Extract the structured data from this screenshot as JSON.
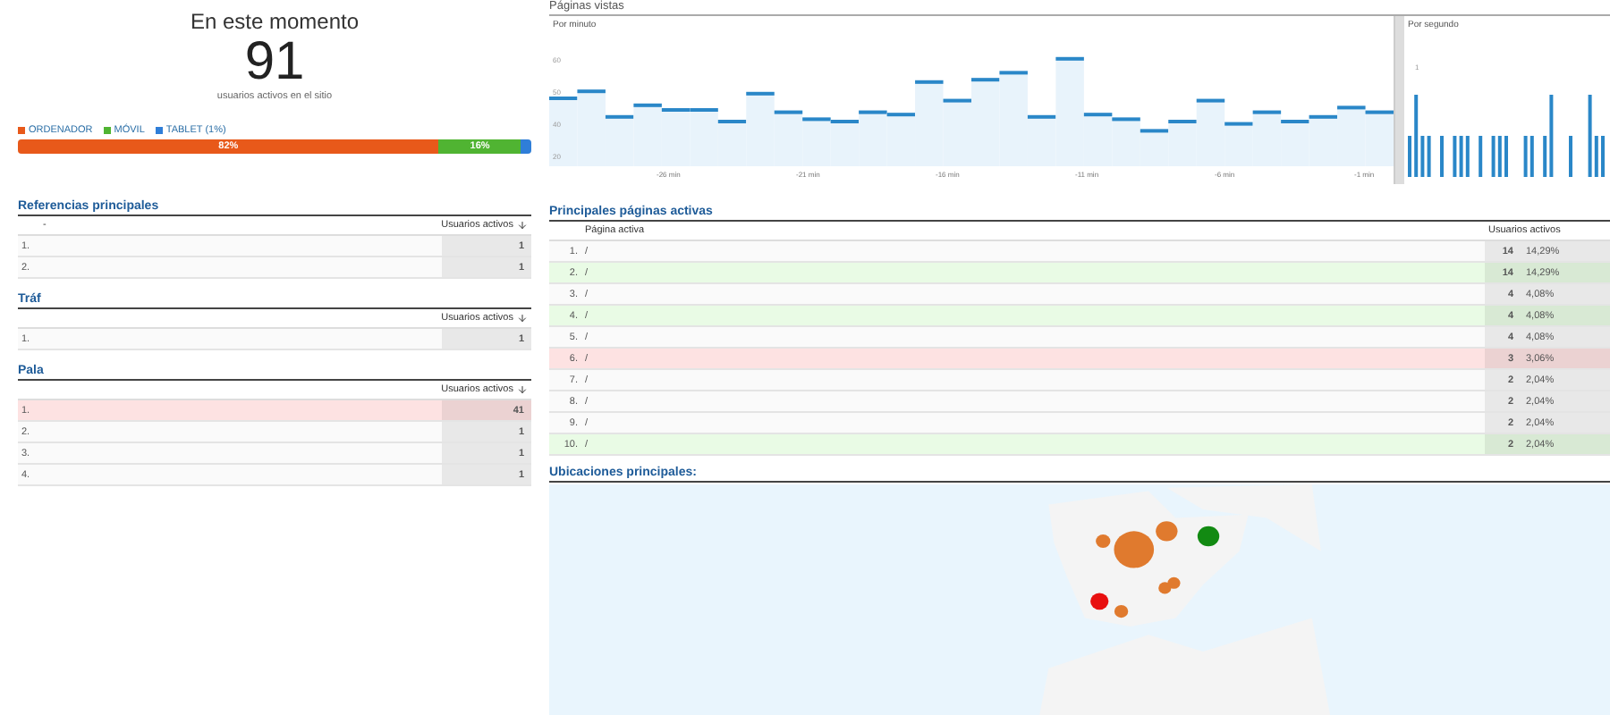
{
  "now": {
    "title": "En este momento",
    "count": "91",
    "caption": "usuarios activos en el sitio",
    "devices": [
      {
        "label": "ORDENADOR",
        "color": "#e8591a",
        "level": 0.82,
        "reading": "82%"
      },
      {
        "label": "MÓVIL",
        "color": "#50b432",
        "level": 0.16,
        "reading": "16%"
      },
      {
        "label": "TABLET (1%)",
        "color": "#2f7ed8",
        "level": 0.02
      }
    ]
  },
  "pageviews": {
    "title": "Páginas vistas",
    "per_minute": {
      "label": "Por minuto",
      "yticks": [
        "60",
        "50",
        "40",
        "20"
      ],
      "xlabels": [
        "-26 min",
        "-21 min",
        "-16 min",
        "-11 min",
        "-6 min",
        "-1 min"
      ]
    },
    "per_second": {
      "label": "Por segundo",
      "yticks": [
        "1"
      ]
    }
  },
  "referrals": {
    "title": "Referencias principales",
    "column_1": "-",
    "value_header": "Usuarios activos",
    "rows": [
      {
        "index": "1.",
        "value": "1"
      },
      {
        "index": "2.",
        "value": "1"
      }
    ]
  },
  "traffic": {
    "title": "Tráf",
    "value_header": "Usuarios activos",
    "rows": [
      {
        "index": "1.",
        "value": "1"
      }
    ]
  },
  "keywords": {
    "title": "Pala",
    "value_header": "Usuarios activos",
    "rows": [
      {
        "index": "1.",
        "value": "41",
        "kind": "down"
      },
      {
        "index": "2.",
        "value": "1",
        "kind": "same"
      },
      {
        "index": "3.",
        "value": "1",
        "kind": "same"
      },
      {
        "index": "4.",
        "value": "1",
        "kind": "same"
      }
    ]
  },
  "pages": {
    "title": "Principales páginas activas",
    "page_header": "Página activa",
    "value_header": "Usuarios activos",
    "rows": [
      {
        "index": "1.",
        "page": "/",
        "value": "14",
        "share": "14,29%",
        "kind": "same"
      },
      {
        "index": "2.",
        "page": "/",
        "value": "14",
        "share": "14,29%",
        "kind": "up"
      },
      {
        "index": "3.",
        "page": "/",
        "value": "4",
        "share": "4,08%",
        "kind": "same"
      },
      {
        "index": "4.",
        "page": "/",
        "value": "4",
        "share": "4,08%",
        "kind": "up"
      },
      {
        "index": "5.",
        "page": "/",
        "value": "4",
        "share": "4,08%",
        "kind": "same"
      },
      {
        "index": "6.",
        "page": "/",
        "value": "3",
        "share": "3,06%",
        "kind": "down"
      },
      {
        "index": "7.",
        "page": "/",
        "value": "2",
        "share": "2,04%",
        "kind": "same"
      },
      {
        "index": "8.",
        "page": "/",
        "value": "2",
        "share": "2,04%",
        "kind": "same"
      },
      {
        "index": "9.",
        "page": "/",
        "value": "2",
        "share": "2,04%",
        "kind": "same"
      },
      {
        "index": "10.",
        "page": "/",
        "value": "2",
        "share": "2,04%",
        "kind": "up"
      }
    ]
  },
  "locations": {
    "title": "Ubicaciones principales:"
  }
}
